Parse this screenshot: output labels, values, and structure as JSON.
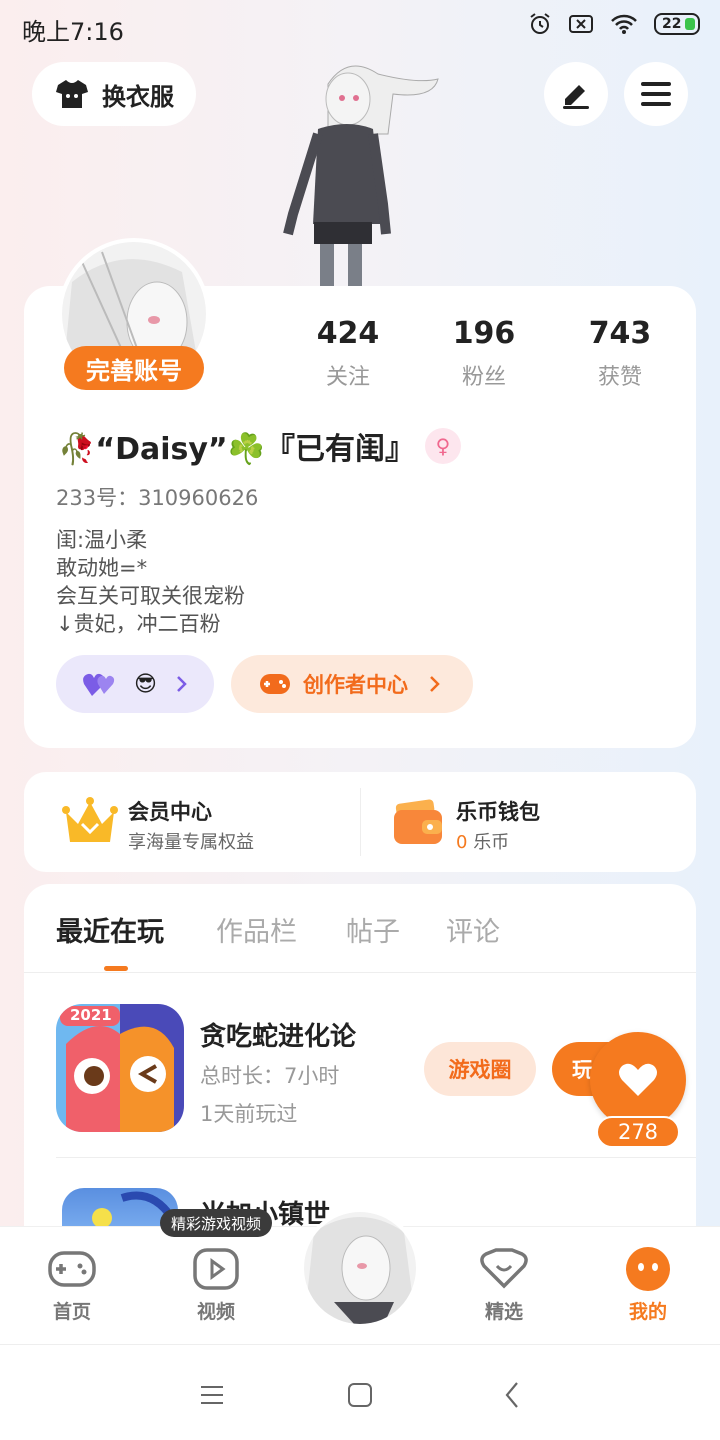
{
  "status_bar": {
    "time": "晚上7:16",
    "battery": "22"
  },
  "header": {
    "outfit_label": "换衣服"
  },
  "profile": {
    "complete_label": "完善账号",
    "stats": [
      {
        "value": "424",
        "label": "关注"
      },
      {
        "value": "196",
        "label": "粉丝"
      },
      {
        "value": "743",
        "label": "获赞"
      }
    ],
    "nickname": "🥀“Daisy”☘️『已有闺』",
    "id_text": "233号：310960626",
    "bio_lines": [
      "闺:温小柔",
      "敢动她=*",
      "会互关可取关很宠粉",
      "↓贵妃，冲二百粉"
    ],
    "creator_center": "创作者中心"
  },
  "vip": {
    "member_title": "会员中心",
    "member_sub": "享海量专属权益",
    "wallet_title": "乐币钱包",
    "wallet_amount": "0",
    "wallet_unit": "乐币"
  },
  "tabs": [
    "最近在玩",
    "作品栏",
    "帖子",
    "评论"
  ],
  "games": [
    {
      "title": "贪吃蛇进化论",
      "duration": "总时长：7小时",
      "last_played": "1天前玩过",
      "circle_label": "游戏圈",
      "play_label": "玩",
      "badge": "2021"
    },
    {
      "title": "米加小镇世"
    }
  ],
  "like_count": "278",
  "tooltip": "精彩游戏视频",
  "bottom_nav": [
    {
      "label": "首页"
    },
    {
      "label": "视频"
    },
    {
      "label": "精选"
    },
    {
      "label": "我的"
    }
  ],
  "colors": {
    "accent": "#f57a1f",
    "purple_pill": "#ebe8fb",
    "orange_pill": "#fde9dc"
  }
}
